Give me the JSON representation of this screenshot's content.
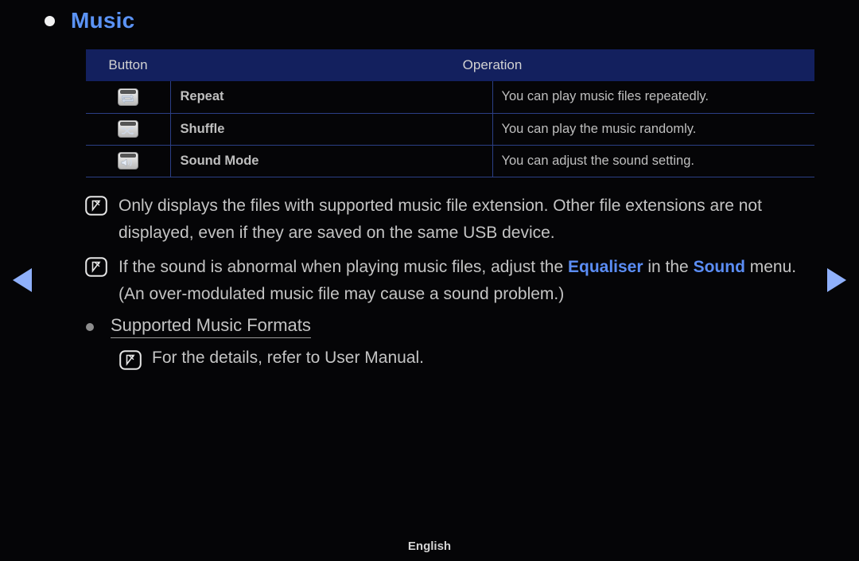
{
  "page": {
    "heading": "Music",
    "footer_language": "English"
  },
  "table": {
    "headers": {
      "button": "Button",
      "operation": "Operation"
    },
    "rows": [
      {
        "icon": "repeat-icon",
        "label": "Repeat",
        "description": "You can play music files repeatedly."
      },
      {
        "icon": "shuffle-icon",
        "label": "Shuffle",
        "description": "You can play the music randomly."
      },
      {
        "icon": "sound-mode-icon",
        "label": "Sound Mode",
        "description": "You can adjust the sound setting."
      }
    ]
  },
  "notes": [
    {
      "icon": "note-pencil-icon",
      "text_parts": [
        {
          "text": "Only displays the files with supported music file extension. Other file extensions are not displayed, even if they are saved on the same USB device.",
          "bold": false
        }
      ]
    },
    {
      "icon": "note-pencil-icon",
      "text_parts": [
        {
          "text": "If the sound is abnormal when playing music files, adjust the ",
          "bold": false
        },
        {
          "text": "Equaliser",
          "bold": true
        },
        {
          "text": " in the ",
          "bold": false
        },
        {
          "text": "Sound",
          "bold": true
        },
        {
          "text": " menu. (An over-modulated music file may cause a sound problem.)",
          "bold": false
        }
      ]
    }
  ],
  "supported_formats": {
    "title": "Supported Music Formats",
    "note": {
      "icon": "note-pencil-icon",
      "text": "For the details, refer to User Manual."
    }
  },
  "navigation": {
    "prev_label": "Previous page",
    "next_label": "Next page"
  },
  "colors": {
    "background": "#050507",
    "accent_blue": "#5b8df5",
    "heading_blue": "#5b93f5",
    "table_header_bg": "#13205e",
    "table_border": "#2b3f86",
    "body_text": "#c4c4c4",
    "arrow_blue": "#8fb0fb"
  }
}
